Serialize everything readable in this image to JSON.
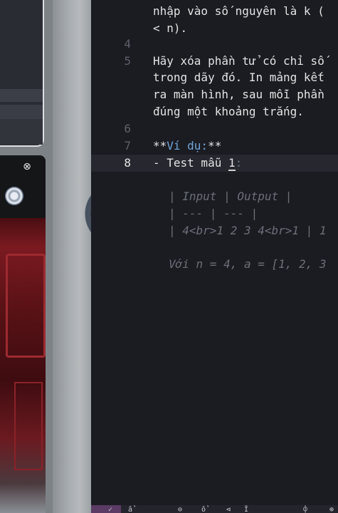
{
  "editor": {
    "lines": [
      {
        "num": "",
        "text": "nhập vào số nguyên là k ("
      },
      {
        "num": "",
        "text": "< n)."
      },
      {
        "num": "4",
        "text": ""
      },
      {
        "num": "5",
        "text": "Hãy xóa phần tử có chỉ số"
      },
      {
        "num": "",
        "text": "trong dãy đó. In mảng kết"
      },
      {
        "num": "",
        "text": "ra màn hình, sau mỗi phần"
      },
      {
        "num": "",
        "text": "đúng một khoảng trắng."
      },
      {
        "num": "6",
        "text": ""
      },
      {
        "num": "7",
        "text_prefix": "**",
        "text_keyword": "Ví dụ:",
        "text_suffix": "**"
      },
      {
        "num": "8",
        "text_prefix": "- Test mẫu ",
        "text_cursor": "1",
        "text_suffix": ":"
      },
      {
        "num": "",
        "text": ""
      },
      {
        "num": "",
        "text": "| Input | Output |"
      },
      {
        "num": "",
        "text": "| --- | --- |"
      },
      {
        "num": "",
        "text": "| 4<br>1 2 3 4<br>1 | 1"
      },
      {
        "num": "",
        "text": ""
      },
      {
        "num": "",
        "text": "Với n = 4, a = [1, 2, 3"
      }
    ]
  },
  "left_window": {
    "close_icon": "⊗"
  },
  "toolbar": {
    "icons": [
      "✓",
      "ẩ",
      "⊖",
      "ổ",
      "⊲",
      "Ī",
      "⌽",
      "⊕"
    ]
  },
  "colors": {
    "editor_bg": "#1b1c22",
    "keyword": "#6fa5d8",
    "current_line": "#26272f"
  }
}
